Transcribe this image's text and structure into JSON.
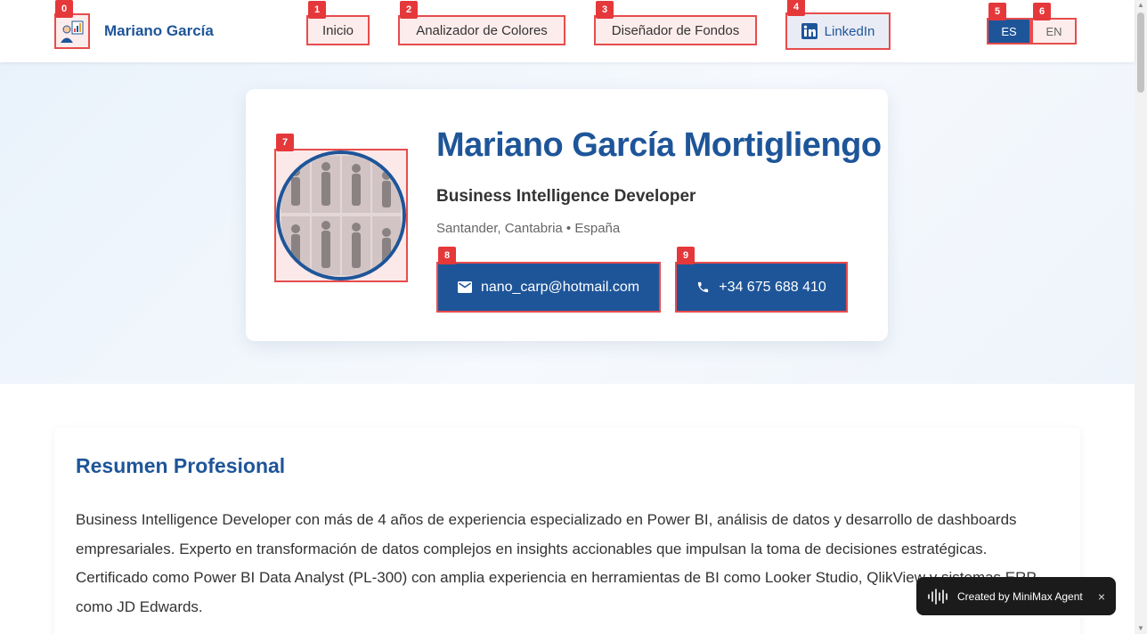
{
  "header": {
    "brand": "Mariano García",
    "nav": [
      {
        "label": "Inicio"
      },
      {
        "label": "Analizador de Colores"
      },
      {
        "label": "Diseñador de Fondos"
      },
      {
        "label": "LinkedIn"
      }
    ],
    "languages": [
      {
        "label": "ES",
        "active": true
      },
      {
        "label": "EN",
        "active": false
      }
    ]
  },
  "hero": {
    "name": "Mariano García Mortigliengo",
    "role": "Business Intelligence Developer",
    "location": "Santander, Cantabria • España",
    "email": "nano_carp@hotmail.com",
    "phone": "+34 675 688 410"
  },
  "summary": {
    "title": "Resumen Profesional",
    "text": "Business Intelligence Developer con más de 4 años de experiencia especializado en Power BI, análisis de datos y desarrollo de dashboards empresariales. Experto en transformación de datos complejos en insights accionables que impulsan la toma de decisiones estratégicas. Certificado como Power BI Data Analyst (PL-300) con amplia experiencia en herramientas de BI como Looker Studio, QlikView y sistemas ERP como JD Edwards."
  },
  "toast": {
    "text": "Created by MiniMax Agent",
    "close": "×"
  },
  "markers": [
    "0",
    "1",
    "2",
    "3",
    "4",
    "5",
    "6",
    "7",
    "8",
    "9"
  ],
  "icons": {
    "logo": "analytics-person-icon",
    "linkedin": "linkedin-icon",
    "email": "mail-icon",
    "phone": "phone-icon",
    "toast": "waveform-icon"
  },
  "colors": {
    "brand": "#1e5599",
    "marker": "#e5383b",
    "toast_bg": "#1b1b1b"
  }
}
